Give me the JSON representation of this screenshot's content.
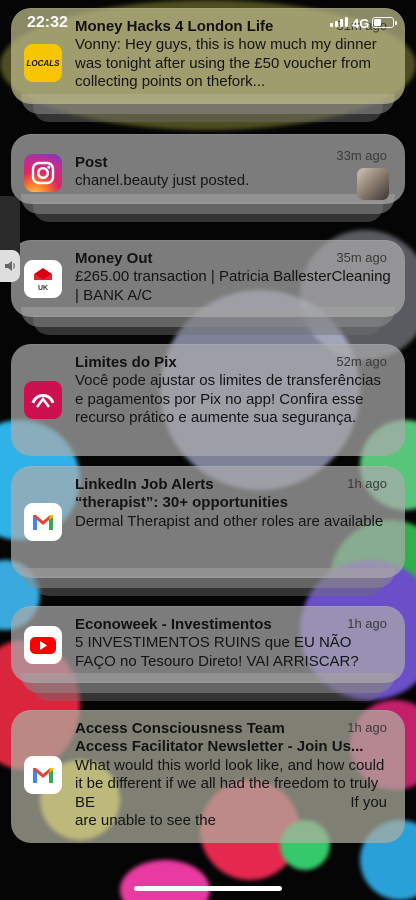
{
  "status_bar": {
    "time": "22:32",
    "network": "4G"
  },
  "notifications": [
    {
      "app": "locals",
      "icon_text": "LOCALS",
      "title": "Money Hacks 4 London Life",
      "time": "31m ago",
      "body": "Vonny: Hey guys, this is how much my dinner was tonight after using the £50 voucher from collecting points on thefork..."
    },
    {
      "app": "instagram",
      "title": "Post",
      "time": "33m ago",
      "body": "chanel.beauty just posted."
    },
    {
      "app": "hsbc",
      "icon_text": "UK",
      "title": "Money Out",
      "time": "35m ago",
      "body": "£265.00 transaction | Patricia BallesterCleaning | BANK A/C"
    },
    {
      "app": "bradesco",
      "title": "Limites do Pix",
      "time": "52m ago",
      "body": "Você pode ajustar os limites de transferências e pagamentos por Pix no app! Confira esse recurso prático e aumente sua segurança."
    },
    {
      "app": "gmail",
      "title": "LinkedIn Job Alerts",
      "time": "1h ago",
      "subject": "“therapist”: 30+ opportunities",
      "body": "Dermal Therapist and other roles are available"
    },
    {
      "app": "youtube",
      "title": "Econoweek - Investimentos",
      "time": "1h ago",
      "body": "5 INVESTIMENTOS RUINS que EU NÃO FAÇO no Tesouro Direto! VAI ARRISCAR?"
    },
    {
      "app": "gmail",
      "title": "Access Consciousness Team",
      "time": "1h ago",
      "subject": "Access Facilitator Newsletter - Join Us...",
      "body_line1": "What would this world look like, and how could it be different if we all had the freedom to truly BE",
      "body_line2": "If you",
      "body_line3": "are unable to see the"
    }
  ]
}
